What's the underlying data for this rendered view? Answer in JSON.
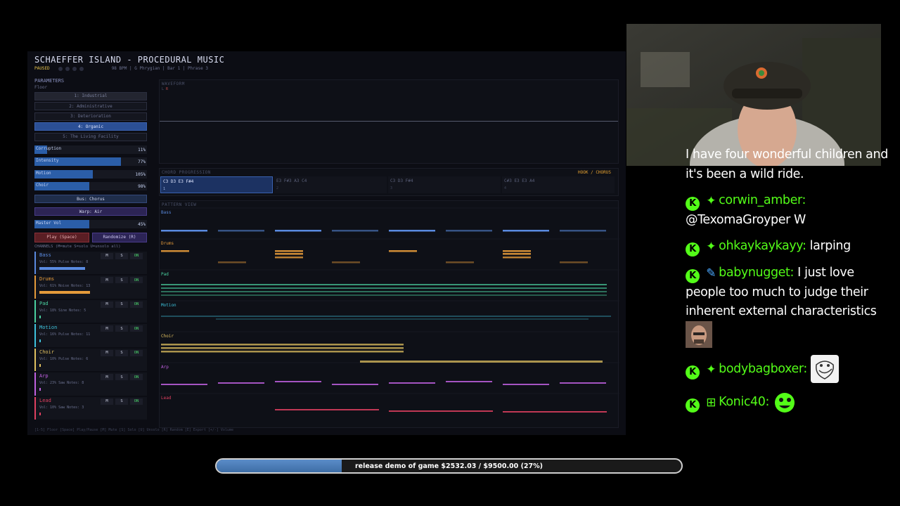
{
  "app": {
    "title": "SCHAEFFER ISLAND - PROCEDURAL MUSIC",
    "status": "PAUSED",
    "info": "98 BPM  |  G Phrygian  |  Bar 1  |  Phrase 3",
    "footer_hint": "[1-5] Floor  [Space] Play/Pause  [M] Mute  [S] Solo  [U] Unsolo  [R] Random  [E] Export  [+/-] Volume"
  },
  "params": {
    "title": "PARAMETERS",
    "floor_label": "Floor",
    "floors": [
      "1: Industrial",
      "2: Administrative",
      "3: Deterioration",
      "4: Organic",
      "5: The Living Facility"
    ],
    "active_floor": 3,
    "sliders": [
      {
        "label": "Corruption",
        "value": "11%",
        "level": 0.11
      },
      {
        "label": "Intensity",
        "value": "77%",
        "level": 0.77
      },
      {
        "label": "Motion",
        "value": "105%",
        "level": 0.52
      },
      {
        "label": "Choir",
        "value": "98%",
        "level": 0.49
      }
    ],
    "bus_chorus": "Bus: Chorus",
    "warp_air": "Warp: Air",
    "master_vol": {
      "label": "Master Vol",
      "value": "45%",
      "level": 0.49
    },
    "play_button": "Play (Space)",
    "randomize_button": "Randomize (R)",
    "channels_hint": "CHANNELS (M=mute  S=solo  U=unsolo all)"
  },
  "channels": [
    {
      "name": "Bass",
      "meta": "Vol: 55%  Pulse  Notes: 8",
      "color": "#5a8ae0",
      "level": 0.55
    },
    {
      "name": "Drums",
      "meta": "Vol: 61%  Noise  Notes: 13",
      "color": "#e49a3a",
      "level": 0.61
    },
    {
      "name": "Pad",
      "meta": "Vol: 18%  Sine  Notes: 5",
      "color": "#4ad0a0",
      "level": 0.02
    },
    {
      "name": "Motion",
      "meta": "Vol: 16%  Pulse  Notes: 11",
      "color": "#3ec2dc",
      "level": 0.02
    },
    {
      "name": "Choir",
      "meta": "Vol: 10%  Pulse  Notes: 6",
      "color": "#e0c060",
      "level": 0.02
    },
    {
      "name": "Arp",
      "meta": "Vol: 23%  Saw  Notes: 8",
      "color": "#c060e0",
      "level": 0.02
    },
    {
      "name": "Lead",
      "meta": "Vol: 10%  Saw  Notes: 3",
      "color": "#e04060",
      "level": 0.02
    }
  ],
  "channel_buttons": {
    "mute": "M",
    "solo": "S",
    "on": "ON"
  },
  "waveform": {
    "label": "WAVEFORM",
    "l": "L",
    "r": "R"
  },
  "chords": {
    "label": "CHORD PROGRESSION",
    "hook": "HOOK / CHORUS",
    "items": [
      {
        "notes": "C3 D3 E3 F#4",
        "num": "1"
      },
      {
        "notes": "E3 F#3 A3 C4",
        "num": "2"
      },
      {
        "notes": "C3 D3 F#4",
        "num": "3"
      },
      {
        "notes": "C#3 E3 E3 A4",
        "num": "4"
      }
    ]
  },
  "pattern": {
    "label": "PATTERN VIEW"
  },
  "chat": {
    "first_message": "I have four wonderful children and it's been a wild ride.",
    "messages": [
      {
        "user": "corwin_amber:",
        "text": "@TexomaGroyper W",
        "icon": "✦",
        "icon_color": "#53fc18"
      },
      {
        "user": "ohkaykaykayy:",
        "text": "larping",
        "icon": "✦",
        "icon_color": "#53fc18"
      },
      {
        "user": "babynugget:",
        "text": "I just love people too much to judge their inherent external characteristics",
        "icon": "✎",
        "icon_color": "#4aa8ff"
      },
      {
        "user": "bodybagboxer:",
        "text": "",
        "icon": "✦",
        "icon_color": "#53fc18"
      },
      {
        "user": "Konic40:",
        "text": "",
        "icon": "⊞",
        "icon_color": "#53fc18"
      }
    ]
  },
  "goal": {
    "text": "release demo of game $2532.03 / $9500.00 (27%)",
    "progress": 0.27
  }
}
